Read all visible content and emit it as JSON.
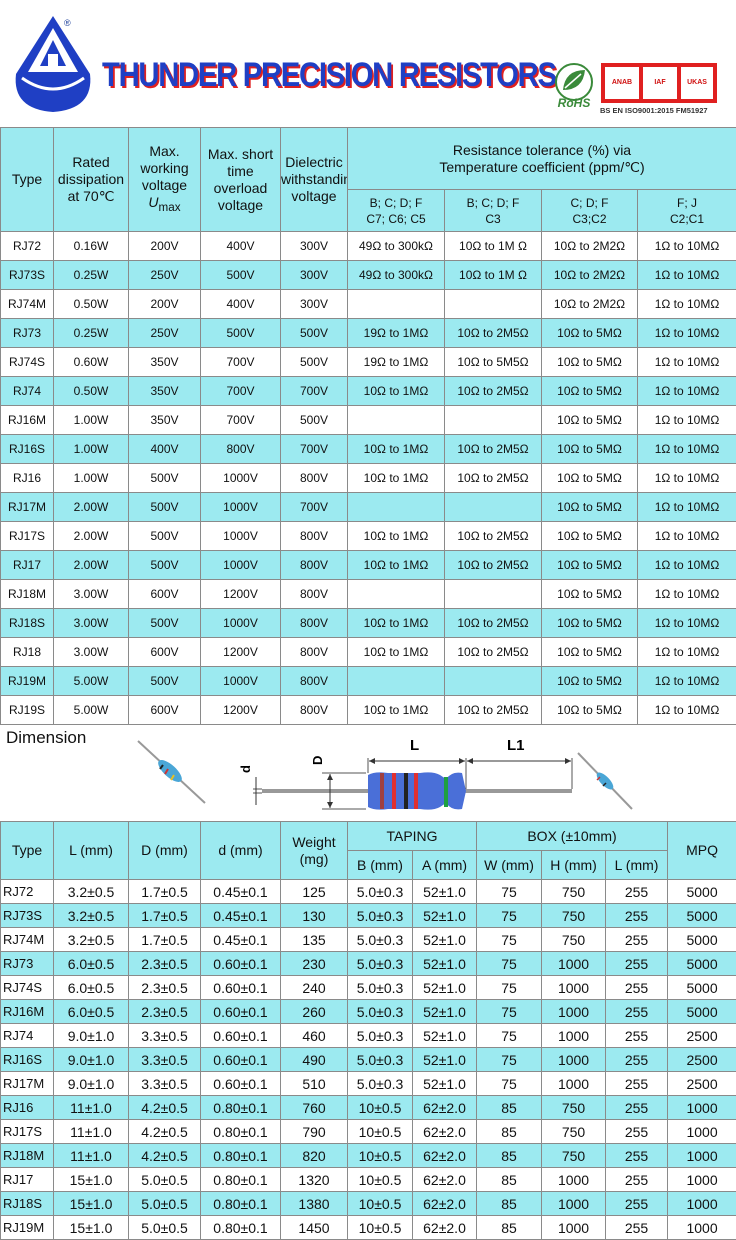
{
  "header": {
    "company": "THUNDER PRECISION RESISTORS",
    "registered_mark": "®",
    "rohs": "RoHS",
    "certification": "BS EN ISO9001:2015 FM51927",
    "cert_badges": [
      "ANAB",
      "IAF",
      "UKAS"
    ],
    "colors": {
      "brand_blue": "#1f3fc4",
      "brand_red": "#e02020",
      "header_cyan": "#9ceaf0"
    }
  },
  "spec_table": {
    "headers": {
      "type": "Type",
      "rated": "Rated dissipation at 70℃",
      "max_working": "Max. working voltage",
      "u_symbol": "U",
      "u_sub": "max",
      "overload": "Max. short time overload voltage",
      "dielectric": "Dielectric withstanding voltage",
      "tolerance": "Resistance tolerance (%)  via",
      "temp_coef": "Temperature coefficient (ppm/℃)",
      "sub": [
        {
          "l1": "B; C; D; F",
          "l2": "C7; C6; C5"
        },
        {
          "l1": "B; C; D; F",
          "l2": "C3"
        },
        {
          "l1": "C; D; F",
          "l2": "C3;C2"
        },
        {
          "l1": "F; J",
          "l2": "C2;C1"
        }
      ]
    },
    "rows": [
      [
        "RJ72",
        "0.16W",
        "200V",
        "400V",
        "300V",
        "49Ω to 300kΩ",
        "10Ω to 1M Ω",
        "10Ω to 2M2Ω",
        "1Ω to 10MΩ"
      ],
      [
        "RJ73S",
        "0.25W",
        "250V",
        "500V",
        "300V",
        "49Ω to 300kΩ",
        "10Ω to 1M Ω",
        "10Ω to 2M2Ω",
        "1Ω to 10MΩ"
      ],
      [
        "RJ74M",
        "0.50W",
        "200V",
        "400V",
        "300V",
        "",
        "",
        "10Ω to 2M2Ω",
        "1Ω to 10MΩ"
      ],
      [
        "RJ73",
        "0.25W",
        "250V",
        "500V",
        "500V",
        "19Ω to 1MΩ",
        "10Ω to 2M5Ω",
        "10Ω to 5MΩ",
        "1Ω to 10MΩ"
      ],
      [
        "RJ74S",
        "0.60W",
        "350V",
        "700V",
        "500V",
        "19Ω to 1MΩ",
        "10Ω to 5M5Ω",
        "10Ω to 5MΩ",
        "1Ω to 10MΩ"
      ],
      [
        "RJ74",
        "0.50W",
        "350V",
        "700V",
        "700V",
        "10Ω to 1MΩ",
        "10Ω to 2M5Ω",
        "10Ω to 5MΩ",
        "1Ω to 10MΩ"
      ],
      [
        "RJ16M",
        "1.00W",
        "350V",
        "700V",
        "500V",
        "",
        "",
        "10Ω to 5MΩ",
        "1Ω to 10MΩ"
      ],
      [
        "RJ16S",
        "1.00W",
        "400V",
        "800V",
        "700V",
        "10Ω to 1MΩ",
        "10Ω to 2M5Ω",
        "10Ω to 5MΩ",
        "1Ω to 10MΩ"
      ],
      [
        "RJ16",
        "1.00W",
        "500V",
        "1000V",
        "800V",
        "10Ω to 1MΩ",
        "10Ω to 2M5Ω",
        "10Ω to 5MΩ",
        "1Ω to 10MΩ"
      ],
      [
        "RJ17M",
        "2.00W",
        "500V",
        "1000V",
        "700V",
        "",
        "",
        "10Ω to 5MΩ",
        "1Ω to 10MΩ"
      ],
      [
        "RJ17S",
        "2.00W",
        "500V",
        "1000V",
        "800V",
        "10Ω to 1MΩ",
        "10Ω to 2M5Ω",
        "10Ω to 5MΩ",
        "1Ω to 10MΩ"
      ],
      [
        "RJ17",
        "2.00W",
        "500V",
        "1000V",
        "800V",
        "10Ω to 1MΩ",
        "10Ω to 2M5Ω",
        "10Ω to 5MΩ",
        "1Ω to 10MΩ"
      ],
      [
        "RJ18M",
        "3.00W",
        "600V",
        "1200V",
        "800V",
        "",
        "",
        "10Ω to 5MΩ",
        "1Ω to 10MΩ"
      ],
      [
        "RJ18S",
        "3.00W",
        "500V",
        "1000V",
        "800V",
        "10Ω to 1MΩ",
        "10Ω to 2M5Ω",
        "10Ω to 5MΩ",
        "1Ω to 10MΩ"
      ],
      [
        "RJ18",
        "3.00W",
        "600V",
        "1200V",
        "800V",
        "10Ω to 1MΩ",
        "10Ω to 2M5Ω",
        "10Ω to 5MΩ",
        "1Ω to 10MΩ"
      ],
      [
        "RJ19M",
        "5.00W",
        "500V",
        "1000V",
        "800V",
        "",
        "",
        "10Ω to 5MΩ",
        "1Ω to 10MΩ"
      ],
      [
        "RJ19S",
        "5.00W",
        "600V",
        "1200V",
        "800V",
        "10Ω to 1MΩ",
        "10Ω to 2M5Ω",
        "10Ω to 5MΩ",
        "1Ω to 10MΩ"
      ]
    ]
  },
  "dimension": {
    "title": "Dimension",
    "labels": {
      "L": "L",
      "L1": "L1",
      "D": "D",
      "d": "d"
    }
  },
  "dim_table": {
    "headers": {
      "type": "Type",
      "L": "L  (mm)",
      "D": "D (mm)",
      "d": "d  (mm)",
      "weight": "Weight (mg)",
      "taping": "TAPING",
      "box": "BOX     (±10mm)",
      "mpq": "MPQ",
      "B": "B (mm)",
      "A": "A (mm)",
      "W": "W (mm)",
      "H": "H (mm)",
      "Lb": "L (mm)"
    },
    "rows": [
      [
        "RJ72",
        "3.2±0.5",
        "1.7±0.5",
        "0.45±0.1",
        "125",
        "5.0±0.3",
        "52±1.0",
        "75",
        "750",
        "255",
        "5000"
      ],
      [
        "RJ73S",
        "3.2±0.5",
        "1.7±0.5",
        "0.45±0.1",
        "130",
        "5.0±0.3",
        "52±1.0",
        "75",
        "750",
        "255",
        "5000"
      ],
      [
        "RJ74M",
        "3.2±0.5",
        "1.7±0.5",
        "0.45±0.1",
        "135",
        "5.0±0.3",
        "52±1.0",
        "75",
        "750",
        "255",
        "5000"
      ],
      [
        "RJ73",
        "6.0±0.5",
        "2.3±0.5",
        "0.60±0.1",
        "230",
        "5.0±0.3",
        "52±1.0",
        "75",
        "1000",
        "255",
        "5000"
      ],
      [
        "RJ74S",
        "6.0±0.5",
        "2.3±0.5",
        "0.60±0.1",
        "240",
        "5.0±0.3",
        "52±1.0",
        "75",
        "1000",
        "255",
        "5000"
      ],
      [
        "RJ16M",
        "6.0±0.5",
        "2.3±0.5",
        "0.60±0.1",
        "260",
        "5.0±0.3",
        "52±1.0",
        "75",
        "1000",
        "255",
        "5000"
      ],
      [
        "RJ74",
        "9.0±1.0",
        "3.3±0.5",
        "0.60±0.1",
        "460",
        "5.0±0.3",
        "52±1.0",
        "75",
        "1000",
        "255",
        "2500"
      ],
      [
        "RJ16S",
        "9.0±1.0",
        "3.3±0.5",
        "0.60±0.1",
        "490",
        "5.0±0.3",
        "52±1.0",
        "75",
        "1000",
        "255",
        "2500"
      ],
      [
        "RJ17M",
        "9.0±1.0",
        "3.3±0.5",
        "0.60±0.1",
        "510",
        "5.0±0.3",
        "52±1.0",
        "75",
        "1000",
        "255",
        "2500"
      ],
      [
        "RJ16",
        "11±1.0",
        "4.2±0.5",
        "0.80±0.1",
        "760",
        "10±0.5",
        "62±2.0",
        "85",
        "750",
        "255",
        "1000"
      ],
      [
        "RJ17S",
        "11±1.0",
        "4.2±0.5",
        "0.80±0.1",
        "790",
        "10±0.5",
        "62±2.0",
        "85",
        "750",
        "255",
        "1000"
      ],
      [
        "RJ18M",
        "11±1.0",
        "4.2±0.5",
        "0.80±0.1",
        "820",
        "10±0.5",
        "62±2.0",
        "85",
        "750",
        "255",
        "1000"
      ],
      [
        "RJ17",
        "15±1.0",
        "5.0±0.5",
        "0.80±0.1",
        "1320",
        "10±0.5",
        "62±2.0",
        "85",
        "1000",
        "255",
        "1000"
      ],
      [
        "RJ18S",
        "15±1.0",
        "5.0±0.5",
        "0.80±0.1",
        "1380",
        "10±0.5",
        "62±2.0",
        "85",
        "1000",
        "255",
        "1000"
      ],
      [
        "RJ19M",
        "15±1.0",
        "5.0±0.5",
        "0.80±0.1",
        "1450",
        "10±0.5",
        "62±2.0",
        "85",
        "1000",
        "255",
        "1000"
      ]
    ]
  }
}
